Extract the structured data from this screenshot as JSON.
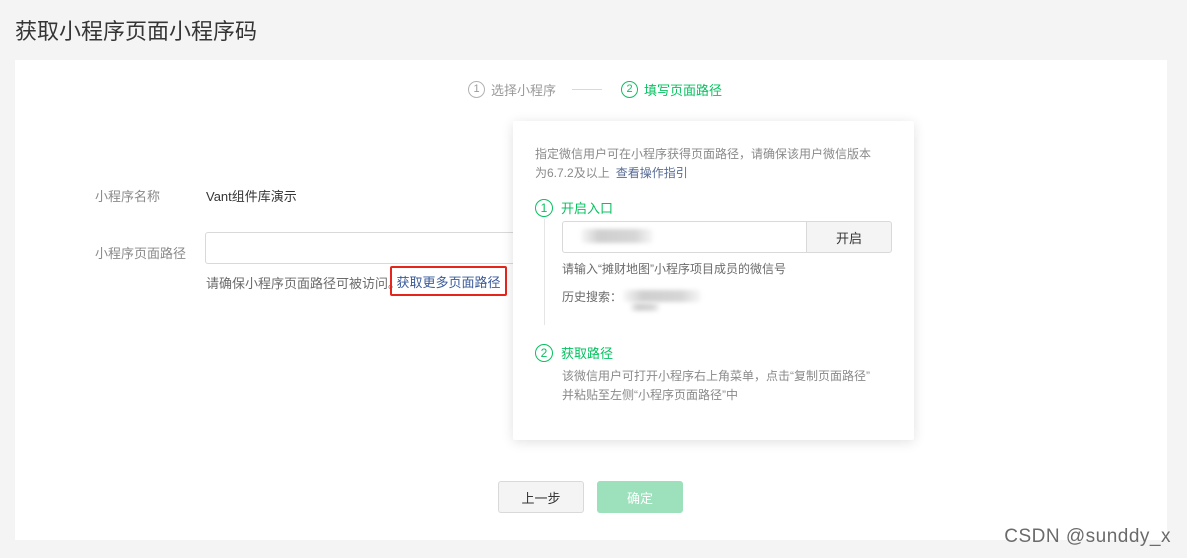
{
  "page": {
    "title": "获取小程序页面小程序码"
  },
  "steps": [
    {
      "num": "1",
      "label": "选择小程序",
      "active": false
    },
    {
      "num": "2",
      "label": "填写页面路径",
      "active": true
    }
  ],
  "form": {
    "name_label": "小程序名称",
    "name_value": "Vant组件库演示",
    "path_label": "小程序页面路径",
    "path_value": "",
    "hint_text": "请确保小程序页面路径可被访问。",
    "more_link": "获取更多页面路径"
  },
  "popover": {
    "desc_line1": "指定微信用户可在小程序获得页面路径，请确保该用户微信版本",
    "desc_line2": "为6.7.2及以上",
    "guide_link": "查看操作指引",
    "step1": {
      "num": "1",
      "title": "开启入口"
    },
    "wx_input_value": "",
    "open_button": "开启",
    "input_hint": "请输入“摊财地图”小程序项目成员的微信号",
    "history_label": "历史搜索：",
    "step2": {
      "num": "2",
      "title": "获取路径"
    },
    "step2_line1": "该微信用户可打开小程序右上角菜单，点击“复制页面路径”",
    "step2_line2": "并粘贴至左侧“小程序页面路径”中"
  },
  "buttons": {
    "prev": "上一步",
    "confirm": "确定"
  },
  "watermark": "CSDN @sunddy_x",
  "colors": {
    "accent": "#07c160",
    "link": "#576b95",
    "highlight": "#e5251c",
    "disabled_btn": "#9ce0bc"
  }
}
